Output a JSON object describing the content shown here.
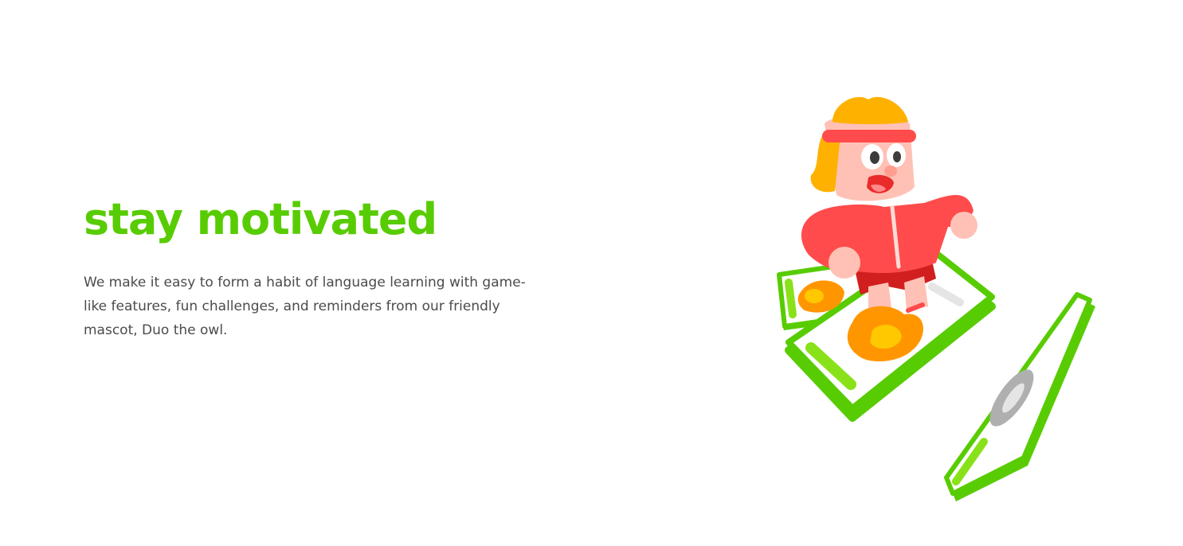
{
  "feature": {
    "title": "stay motivated",
    "description": "We make it easy to form a habit of language learning with game-like features, fun challenges, and reminders from our friendly mascot, Duo the owl."
  },
  "colors": {
    "brand_green": "#58cc02",
    "body_text": "#4b4b4b",
    "jacket_red": "#ff4b4b",
    "hair_yellow": "#ffb100",
    "flame_orange": "#ff9600"
  },
  "illustration": {
    "icon": "running-character-on-phones-illustration"
  }
}
